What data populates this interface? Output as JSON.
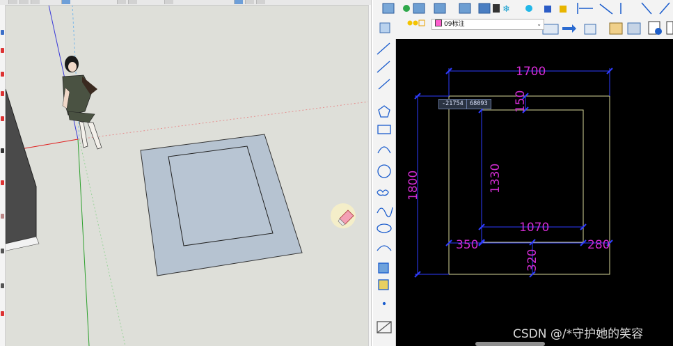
{
  "sketchup": {
    "tool_cursor": "eraser-icon"
  },
  "cad": {
    "layer_dropdown": {
      "value": "09标注",
      "swatch_color": "#ff5ecf"
    },
    "coords": {
      "x": "-21754",
      "y": "68093"
    },
    "dimensions": {
      "top_width": "1700",
      "left_height": "1800",
      "top_offset": "150",
      "inner_height": "1330",
      "inner_width": "1070",
      "left_offset": "350",
      "right_offset": "280",
      "bottom_offset": "320"
    },
    "colors": {
      "dim_text": "#d22bd2",
      "dim_line": "#2e3cff",
      "outline": "#d8d89a"
    }
  },
  "watermark": "CSDN @/*守护她的笑容"
}
